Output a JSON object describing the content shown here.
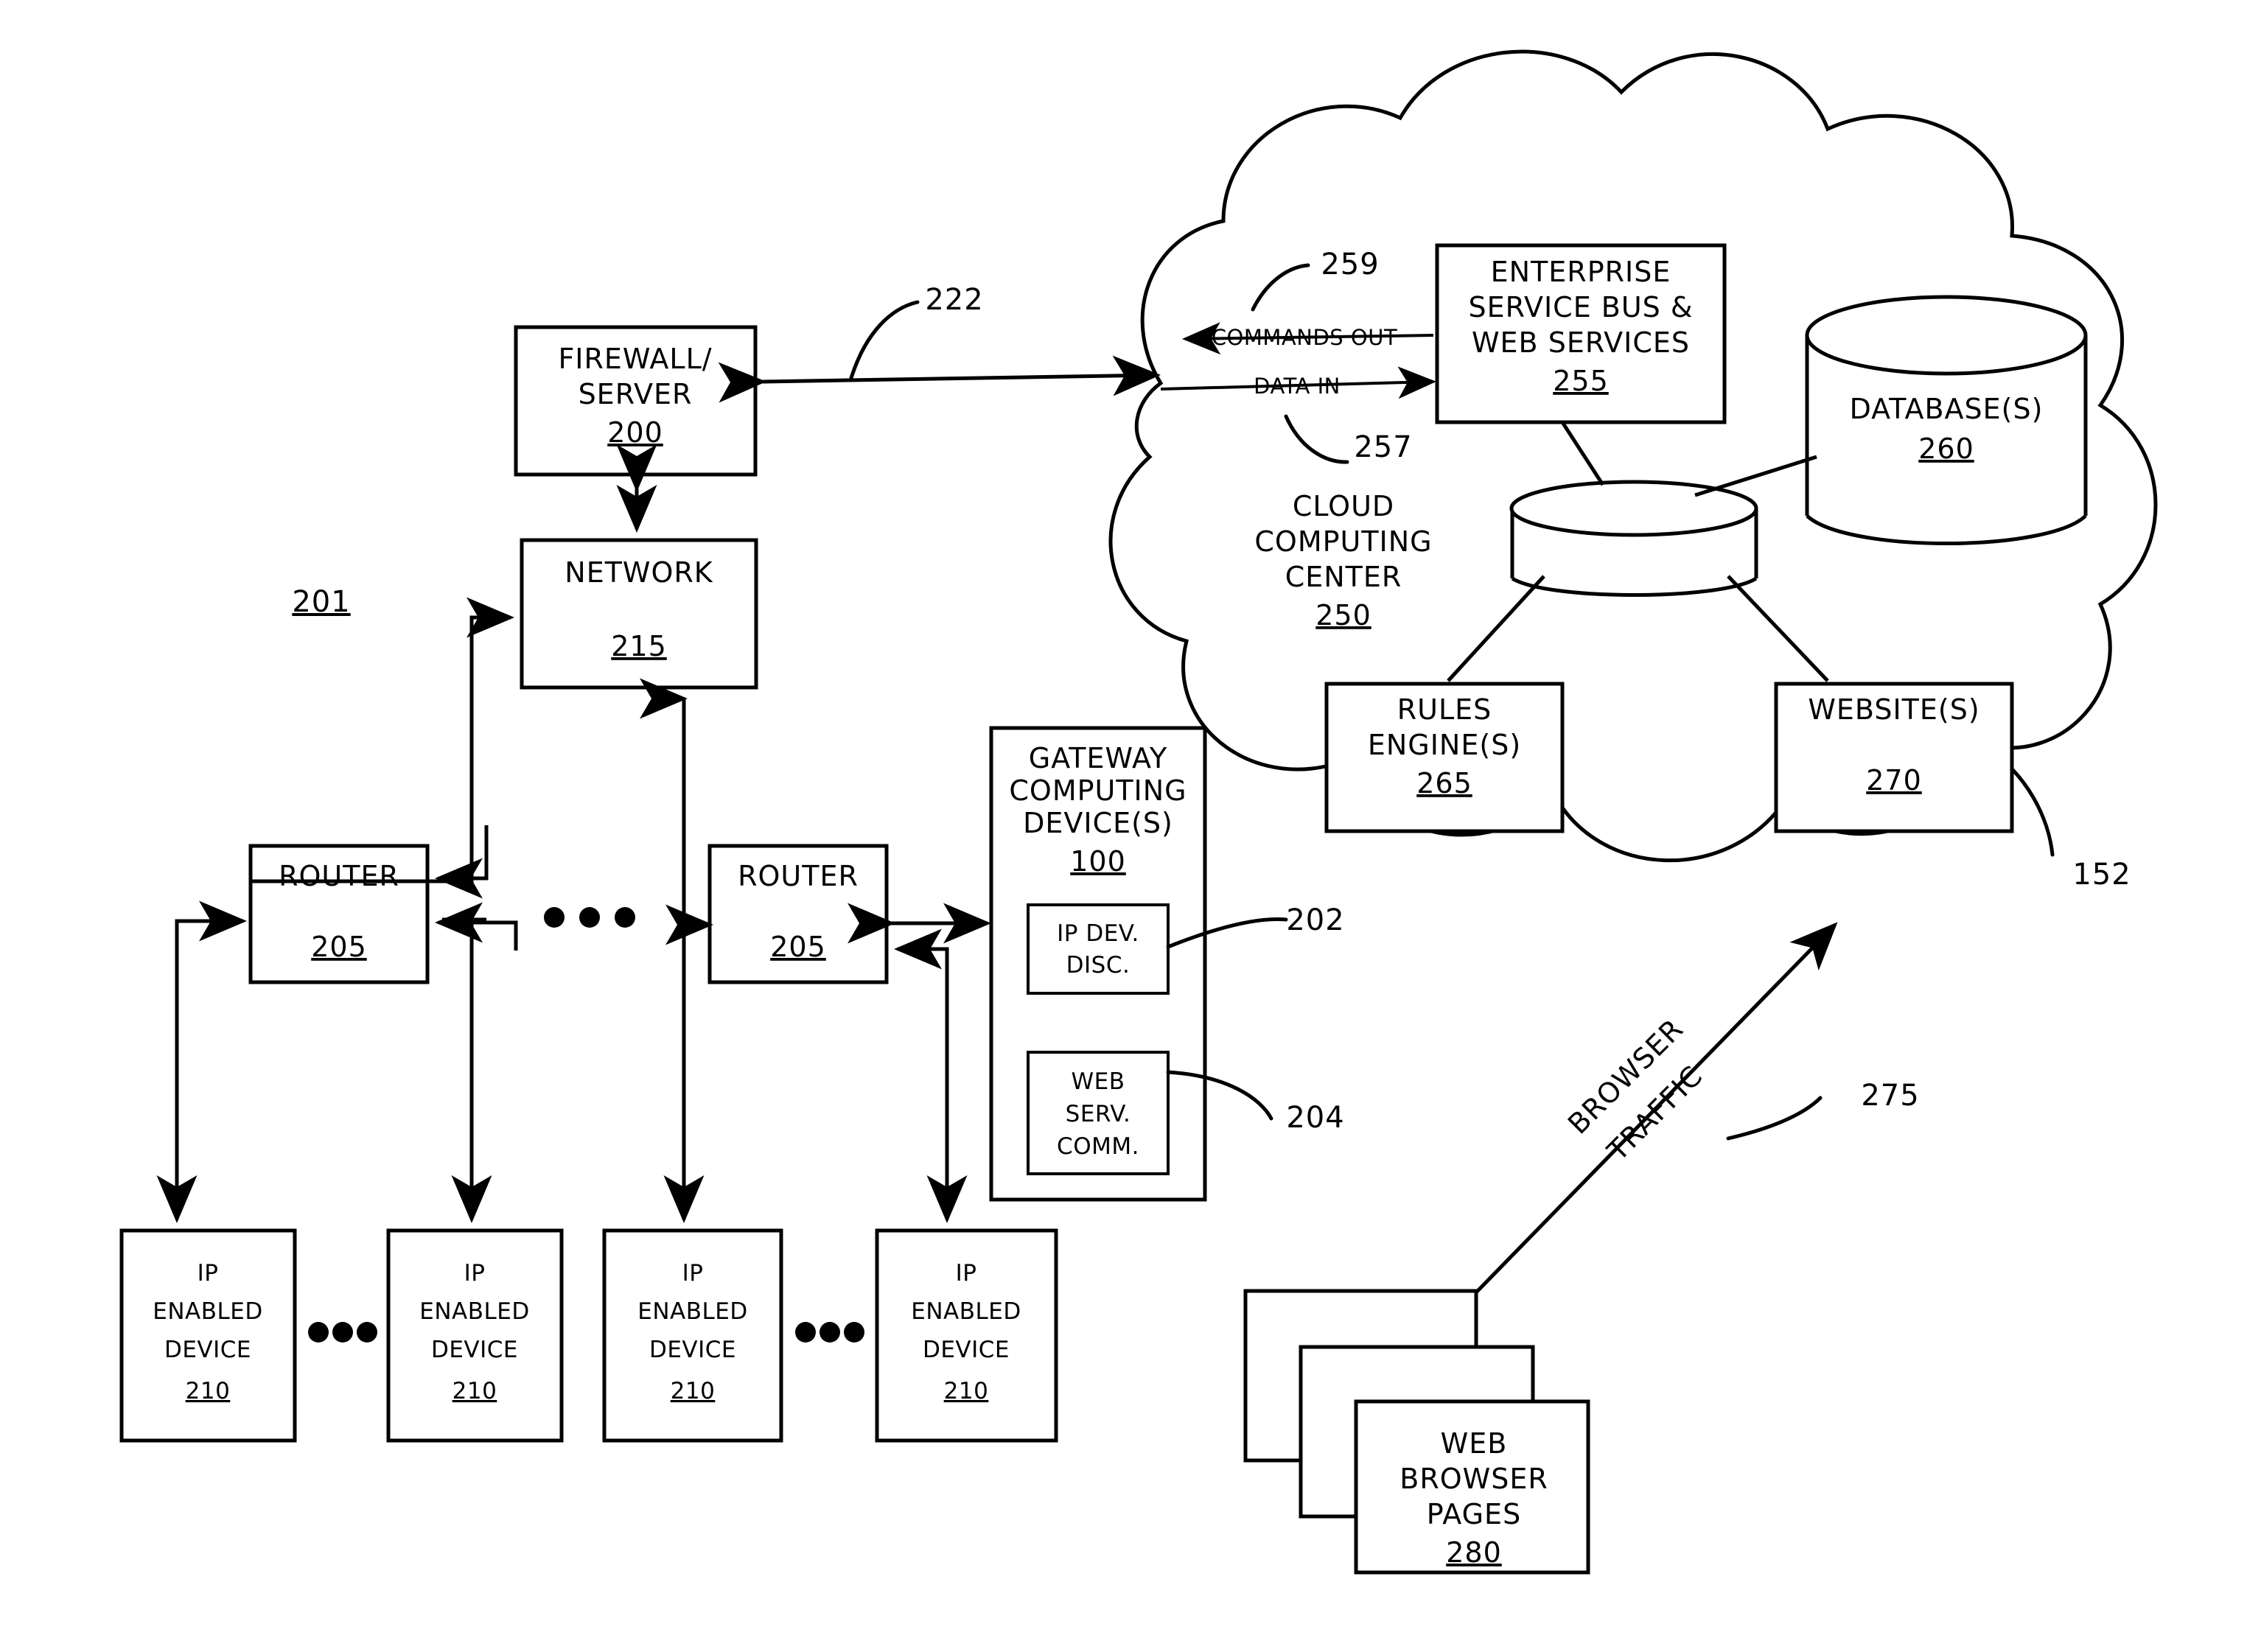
{
  "figure": {
    "type": "patent-network-architecture-diagram",
    "background_color": "#ffffff",
    "line_color": "#000000"
  },
  "boxes": {
    "firewall": {
      "line1": "FIREWALL/",
      "line2": "SERVER",
      "ref": "200"
    },
    "network": {
      "line1": "NETWORK",
      "ref": "215"
    },
    "router_left": {
      "line1": "ROUTER",
      "ref": "205"
    },
    "router_right": {
      "line1": "ROUTER",
      "ref": "205"
    },
    "gateway": {
      "line1": "GATEWAY",
      "line2": "COMPUTING",
      "line3": "DEVICE(S)",
      "ref": "100"
    },
    "ip_dev_disc": {
      "line1": "IP DEV.",
      "line2": "DISC."
    },
    "web_serv_comm": {
      "line1": "WEB",
      "line2": "SERV.",
      "line3": "COMM."
    },
    "esb": {
      "line1": "ENTERPRISE",
      "line2": "SERVICE BUS &",
      "line3": "WEB SERVICES",
      "ref": "255"
    },
    "database": {
      "line1": "DATABASE(S)",
      "ref": "260"
    },
    "rules_engine": {
      "line1": "RULES",
      "line2": "ENGINE(S)",
      "ref": "265"
    },
    "websites": {
      "line1": "WEBSITE(S)",
      "ref": "270"
    },
    "web_browser_pages": {
      "line1": "WEB",
      "line2": "BROWSER",
      "line3": "PAGES",
      "ref": "280"
    }
  },
  "ip_devices": [
    {
      "line1": "IP",
      "line2": "ENABLED",
      "line3": "DEVICE",
      "ref": "210"
    },
    {
      "line1": "IP",
      "line2": "ENABLED",
      "line3": "DEVICE",
      "ref": "210"
    },
    {
      "line1": "IP",
      "line2": "ENABLED",
      "line3": "DEVICE",
      "ref": "210"
    },
    {
      "line1": "IP",
      "line2": "ENABLED",
      "line3": "DEVICE",
      "ref": "210"
    }
  ],
  "cloud": {
    "label_line1": "CLOUD",
    "label_line2": "COMPUTING",
    "label_line3": "CENTER",
    "ref": "250",
    "boundary_ref": "152"
  },
  "flow_labels": {
    "commands_out": "COMMANDS OUT",
    "data_in": "DATA IN",
    "browser_traffic_line1": "BROWSER",
    "browser_traffic_line2": "TRAFFIC"
  },
  "reference_numerals": {
    "local_network": "201",
    "firewall_link": "222",
    "ip_dev_disc": "202",
    "web_serv_comm": "204",
    "data_in": "257",
    "commands_out": "259",
    "browser_traffic": "275",
    "cloud_boundary": "152"
  },
  "ellipses": {
    "between_routers": "• • •",
    "between_devices_left": "• • •",
    "between_devices_right": "• • •"
  }
}
